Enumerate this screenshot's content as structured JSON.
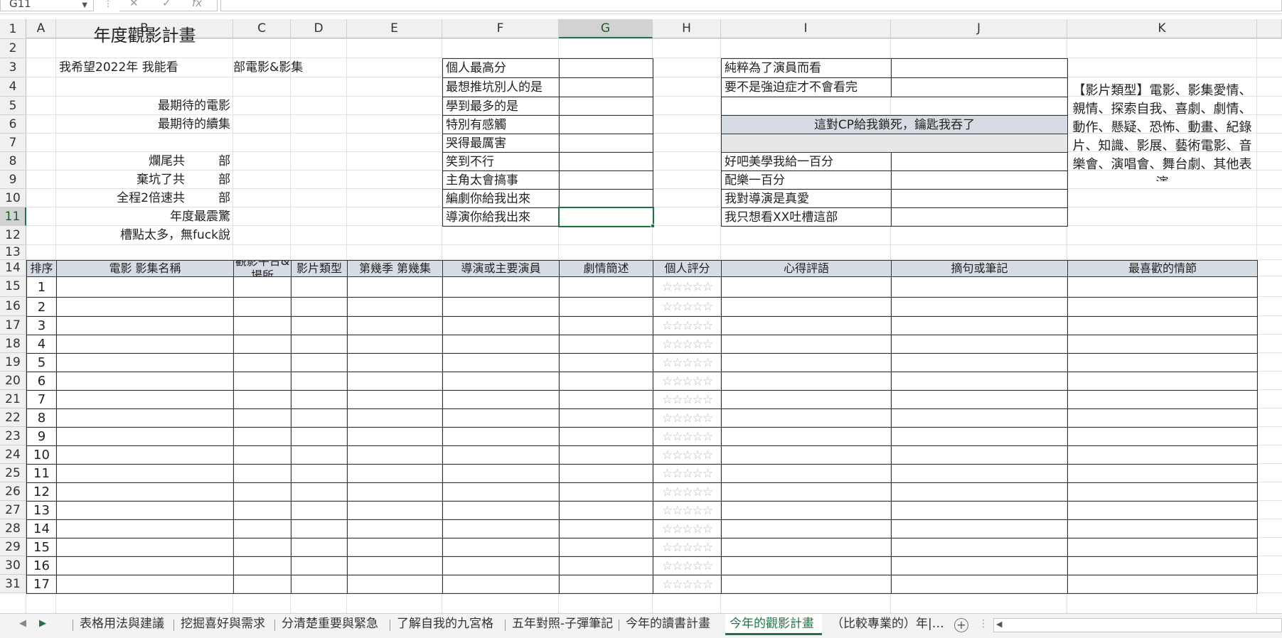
{
  "name_box": "G11",
  "formula_bar": {
    "fx_label": "fx",
    "cancel": "✕",
    "confirm": "✓",
    "value": ""
  },
  "columns": [
    "A",
    "B",
    "C",
    "D",
    "E",
    "F",
    "G",
    "H",
    "I",
    "J",
    "K"
  ],
  "selected_column": "G",
  "selected_row": "11",
  "rows": [
    "1",
    "2",
    "3",
    "4",
    "5",
    "6",
    "7",
    "8",
    "9",
    "10",
    "11",
    "12",
    "13",
    "14",
    "15",
    "16",
    "17",
    "18",
    "19",
    "20",
    "21",
    "22",
    "23",
    "24",
    "25",
    "26",
    "27",
    "28",
    "29",
    "30",
    "31"
  ],
  "sheet": {
    "title": "年度觀影計畫",
    "goal_prefix": "我希望2022年 我能看",
    "goal_suffix": "部電影&影集",
    "most_anticipated_movie": "最期待的電影",
    "most_anticipated_series": "最期待的續集",
    "bad_ending": "爛尾共",
    "abandoned": "棄坑了共",
    "double_speed": "全程2倍速共",
    "unit": "部",
    "most_shocking": "年度最震驚",
    "too_many_complaints": "槽點太多，無fuck說",
    "awards_left": [
      "個人最高分",
      "最想推坑別人的是",
      "學到最多的是",
      "特別有感觸",
      "哭得最厲害",
      "笑到不行",
      "主角太會搞事",
      "編劇你給我出來",
      "導演你給我出來"
    ],
    "awards_right_top": [
      "純粹為了演員而看",
      "要不是強迫症才不會看完"
    ],
    "cp_banner": "這對CP給我鎖死，鑰匙我吞了",
    "awards_right_bottom": [
      "好吧美學我給一百分",
      "配樂一百分",
      "我對導演是真愛",
      "我只想看XX吐槽這部"
    ],
    "genre_note": "【影片類型】電影、影集愛情、親情、探索自我、喜劇、劇情、動作、懸疑、恐怖、動畫、紀錄片、知識、影展、藝術電影、音樂會、演唱會、舞台劇、其他表演",
    "table_headers": [
      "排序",
      "電影 影集名稱",
      "觀影平台&場所",
      "影片類型",
      "第幾季 第幾集",
      "導演或主要演員",
      "劇情簡述",
      "個人評分",
      "心得評語",
      "摘句或筆記",
      "最喜歡的情節"
    ],
    "row_numbers": [
      "1",
      "2",
      "3",
      "4",
      "5",
      "6",
      "7",
      "8",
      "9",
      "10",
      "11",
      "12",
      "13",
      "14",
      "15",
      "16",
      "17"
    ],
    "rating_stars": "☆☆☆☆☆"
  },
  "tabs": [
    "表格用法與建議",
    "挖掘喜好與需求",
    "分清楚重要與緊急",
    "了解自我的九宮格",
    "五年對照-子彈筆記",
    "今年的讀書計畫",
    "今年的觀影計畫",
    "（比較專業的）年|…"
  ],
  "active_tab": "今年的觀影計畫",
  "add_sheet": "+",
  "tab_more": "⋮"
}
